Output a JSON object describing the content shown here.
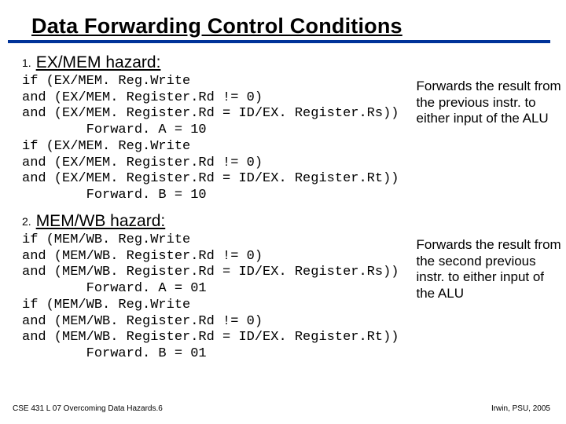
{
  "title": "Data Forwarding Control Conditions",
  "sections": [
    {
      "num": "1.",
      "label": "EX/MEM hazard:",
      "code": "if (EX/MEM. Reg.Write\nand (EX/MEM. Register.Rd != 0)\nand (EX/MEM. Register.Rd = ID/EX. Register.Rs))\n        Forward. A = 10\nif (EX/MEM. Reg.Write\nand (EX/MEM. Register.Rd != 0)\nand (EX/MEM. Register.Rd = ID/EX. Register.Rt))\n        Forward. B = 10",
      "note": "Forwards the result from the previous instr. to either input of the ALU"
    },
    {
      "num": "2.",
      "label": "MEM/WB hazard:",
      "code": "if (MEM/WB. Reg.Write\nand (MEM/WB. Register.Rd != 0)\nand (MEM/WB. Register.Rd = ID/EX. Register.Rs))\n        Forward. A = 01\nif (MEM/WB. Reg.Write\nand (MEM/WB. Register.Rd != 0)\nand (MEM/WB. Register.Rd = ID/EX. Register.Rt))\n        Forward. B = 01",
      "note": "Forwards the result from the second previous instr. to either input of the ALU"
    }
  ],
  "footer": {
    "left": "CSE 431 L 07 Overcoming Data Hazards.6",
    "right": "Irwin, PSU, 2005"
  }
}
